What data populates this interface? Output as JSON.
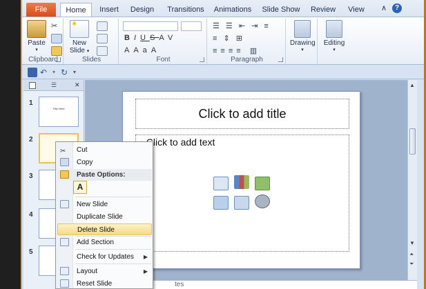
{
  "ribbon_tabs": {
    "file": "File",
    "home": "Home",
    "insert": "Insert",
    "design": "Design",
    "transitions": "Transitions",
    "animations": "Animations",
    "slide_show": "Slide Show",
    "review": "Review",
    "view": "View"
  },
  "ribbon": {
    "clipboard": {
      "label": "Clipboard",
      "paste": "Paste"
    },
    "slides": {
      "label": "Slides",
      "new_slide_line1": "New",
      "new_slide_line2": "Slide"
    },
    "font": {
      "label": "Font",
      "bold": "B",
      "italic": "I",
      "underline": "U",
      "strike": "S",
      "shadow": "abe",
      "spacing": "AV",
      "case": "Aa",
      "grow": "A",
      "color": "A"
    },
    "paragraph": {
      "label": "Paragraph"
    },
    "drawing": {
      "label": "Drawing"
    },
    "editing": {
      "label": "Editing"
    }
  },
  "slide_panel": {
    "tabs_close": "✕",
    "slides": [
      {
        "num": "1",
        "text": "Title Here"
      },
      {
        "num": "2",
        "text": ""
      },
      {
        "num": "3",
        "text": ""
      },
      {
        "num": "4",
        "text": ""
      },
      {
        "num": "5",
        "text": ""
      }
    ]
  },
  "slide": {
    "title_placeholder": "Click to add title",
    "body_placeholder": "Click to add text",
    "bullet": "•"
  },
  "notes": {
    "text": "tes"
  },
  "context_menu": {
    "cut": "Cut",
    "copy": "Copy",
    "paste_options": "Paste Options:",
    "paste_keep": "A",
    "new_slide": "New Slide",
    "duplicate_slide": "Duplicate Slide",
    "delete_slide": "Delete Slide",
    "add_section": "Add Section",
    "check_updates": "Check for Updates",
    "layout": "Layout",
    "reset_slide": "Reset Slide"
  },
  "colors": {
    "file_tab": "#d44d1c",
    "frame": "#b7772a",
    "highlight": "#f7d988"
  }
}
